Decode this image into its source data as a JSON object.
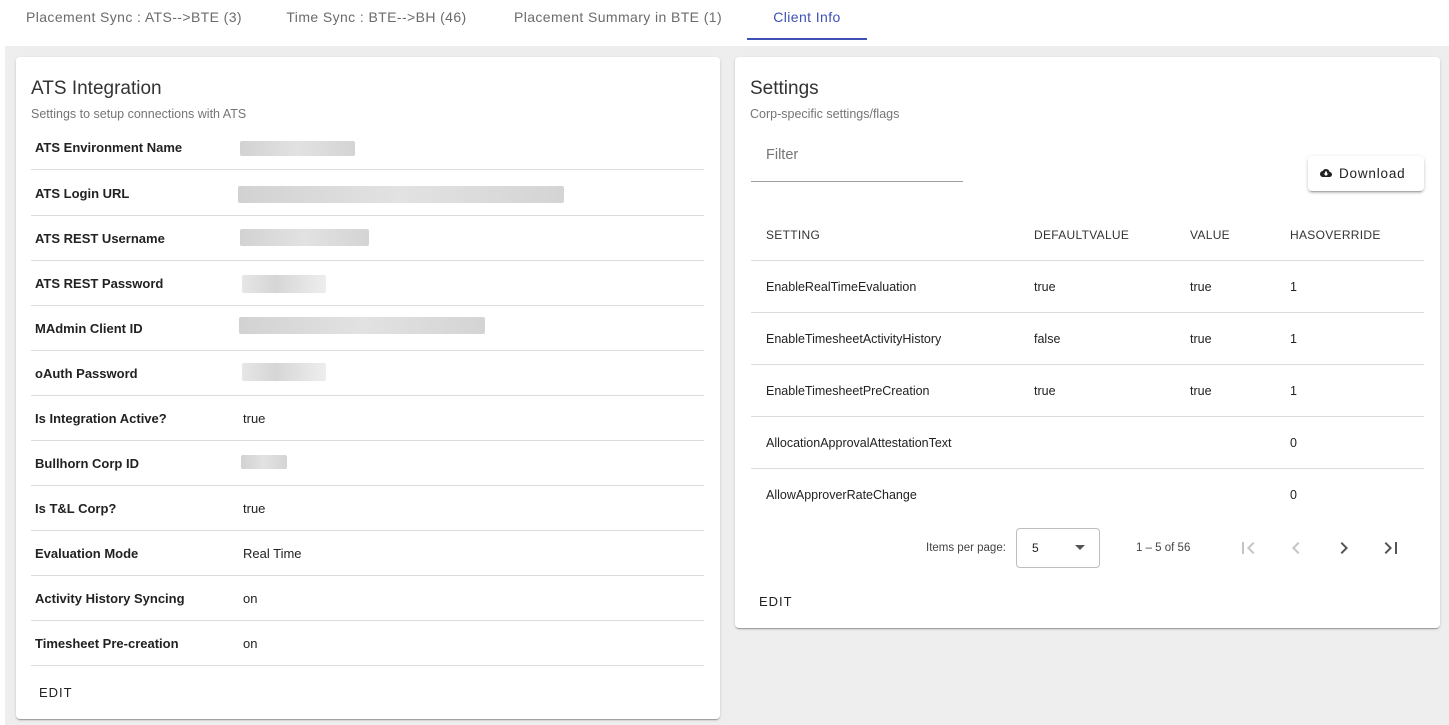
{
  "tabs": [
    {
      "label": "Placement Sync : ATS-->BTE (3)"
    },
    {
      "label": "Time Sync : BTE-->BH (46)"
    },
    {
      "label": "Placement Summary in BTE (1)"
    },
    {
      "label": "Client Info"
    }
  ],
  "active_tab": "Client Info",
  "colors": {
    "accent": "#3f51b5",
    "background": "#eeeeee"
  },
  "ats_integration": {
    "title": "ATS Integration",
    "subtitle": "Settings to setup connections with ATS",
    "fields": [
      {
        "label": "ATS Environment Name",
        "value": null
      },
      {
        "label": "ATS Login URL",
        "value": null
      },
      {
        "label": "ATS REST Username",
        "value": null
      },
      {
        "label": "ATS REST Password",
        "value": null
      },
      {
        "label": "MAdmin Client ID",
        "value": null
      },
      {
        "label": "oAuth Password",
        "value": null
      },
      {
        "label": "Is Integration Active?",
        "value": "true"
      },
      {
        "label": "Bullhorn Corp ID",
        "value": null
      },
      {
        "label": "Is T&L Corp?",
        "value": "true"
      },
      {
        "label": "Evaluation Mode",
        "value": "Real Time"
      },
      {
        "label": "Activity History Syncing",
        "value": "on"
      },
      {
        "label": "Timesheet Pre-creation",
        "value": "on"
      }
    ],
    "edit_label": "EDIT"
  },
  "settings": {
    "title": "Settings",
    "subtitle": "Corp-specific settings/flags",
    "filter_placeholder": "Filter",
    "download_label": "Download",
    "download_icon": "cloud-download-icon",
    "columns": [
      "SETTING",
      "DEFAULTVALUE",
      "VALUE",
      "HASOVERRIDE"
    ],
    "rows": [
      [
        "EnableRealTimeEvaluation",
        "true",
        "true",
        "1"
      ],
      [
        "EnableTimesheetActivityHistory",
        "false",
        "true",
        "1"
      ],
      [
        "EnableTimesheetPreCreation",
        "true",
        "true",
        "1"
      ],
      [
        "AllocationApprovalAttestationText",
        "",
        "",
        "0"
      ],
      [
        "AllowApproverRateChange",
        "",
        "",
        "0"
      ]
    ],
    "paginator": {
      "items_per_page_label": "Items per page:",
      "page_size": "5",
      "range_label": "1 – 5 of 56",
      "icons": [
        "first-page-icon",
        "previous-page-icon",
        "next-page-icon",
        "last-page-icon"
      ]
    },
    "edit_label": "EDIT"
  }
}
